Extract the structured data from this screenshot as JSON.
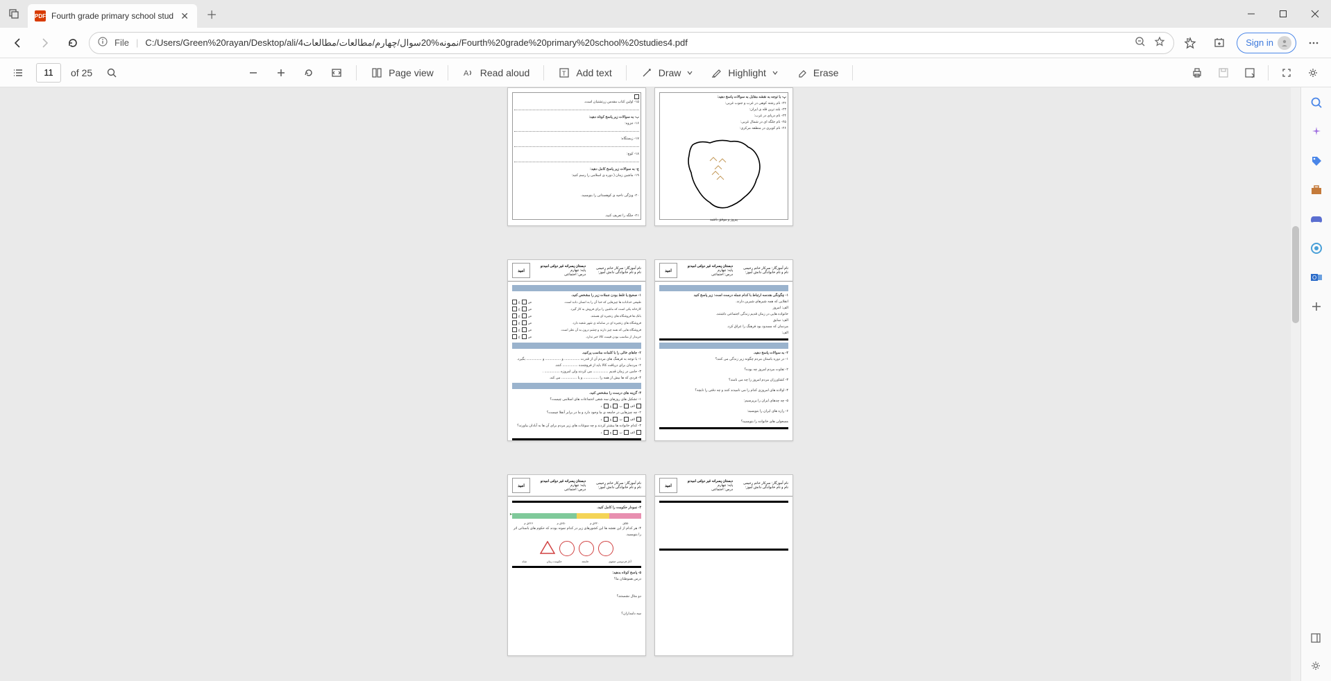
{
  "tab": {
    "title": "Fourth grade primary school stud"
  },
  "address": {
    "file_label": "File",
    "url": "C:/Users/Green%20rayan/Desktop/ali/نمونه%20سوال/چهارم/مطالعات/مطالعات4/Fourth%20grade%20primary%20school%20studies4.pdf"
  },
  "signin": "Sign in",
  "pdf_toolbar": {
    "page_current": "11",
    "page_total_label": "of 25",
    "page_view": "Page view",
    "read_aloud": "Read aloud",
    "add_text": "Add text",
    "draw": "Draw",
    "highlight": "Highlight",
    "erase": "Erase"
  },
  "doc": {
    "school_name": "دبستان پسرانه غیر دولتی امیدنو",
    "teacher": "نام آموزگار: سرکار خانم رحیمی",
    "grade": "پایه: چهارم",
    "subject": "درس: اجتماعی",
    "student": "نام و نام خانوادگی دانش آموز:",
    "logo_text": "امید",
    "page10": {
      "line1": "۱۵- اولین کتاب مقدس زرتشتیان است.",
      "section_title": "ب- به سوالات زیر پاسخ کوتاه دهید:",
      "item16": "۱۶- جزوه:",
      "item17": "۱۷- زیستگاه:",
      "item18": "۱۸- کوچ:",
      "section2": "ج- به سوالات زیر پاسخ کامل دهید:",
      "q19": "۱۹- ماشین زمان ( دوره ی اسلامی را رسم کنید:",
      "q20": "۲۰- ویژگی ناحیه ی کوهستانی را بنویسید.",
      "q21": "۲۱- جلگه را تعریف کنید."
    },
    "page11": {
      "title": "پ- با توجه به نقشه مقابل به سوالات پاسخ دهید:",
      "q22": "۲۲- نام رشته کوهی در غرب و جنوب غربی:",
      "q23": "۲۳- بلند ترین قله ی ایران:",
      "q24": "۲۴- نام دریای در غرب:",
      "q25": "۲۵- نام جلگه ای در شمال غربی:",
      "q26": "۲۶- نام کویری در منطقه مرکزی:",
      "footer": "پیروز و موفق باشید"
    },
    "page12": {
      "sec1": "۱- صحیح یا غلط بودن جملات زیر را مشخص کنید.",
      "r1": "طبیعی خداداده ها چیزهایی که خدا آن را به انسان داده است.",
      "r2": "کارخانه یکی است که ماشین را برای فروش به کار گیرد.",
      "r3": "بانک ها فروشگاه های زنجیره ای هستند.",
      "r4": "فروشگاه های زنجیره ای در سامانه ی شهر شعبه دارد.",
      "r5": "فروشگاه هایی که همه چیز دارند و چشم درون به آن نظر است.",
      "r6": "خریدار از مناسب بودن قیمت کالا خبر ندارد.",
      "l_correct": "ص",
      "l_wrong": "غ",
      "sec2": "۲- جاهای خالی را با کلمات مناسب پرکنید.",
      "f1": "۱- با توجه به فرهنگ های مردم آن از قدرت ................ و ................ و ................ بگیرد.",
      "f2": "۲- مردمان برای دریافت کالا باید از فروشنده ................ کنند.",
      "f3": "۳- حامی در زمان قدیم ................ می کردند ولی امروزه ................ .",
      "f4": "۴- فردی که ها بیش از همه را ................ و یا ................ می کند.",
      "sec3": "۳- گزینه های درست را مشخص کنید.",
      "mc1": "۱- تشکیل های روزهای سه شقی اجتماعات های اسلامی چیست؟",
      "mc2": "۲- چه چیزهایی در جامعه ی ما وجود دارد و ما در برابر آنفلا چیست؟",
      "mc3": "۳- کدام خانواده ها بیشتر کردند و چه سوغات های زیر مردم برای آن ها به آبادان بیاورند؟"
    },
    "page13": {
      "sec1": "۱- چگونگی هندسه ارتباط با کدام جمله درست است: زیر پاسخ کنید",
      "r1": "انقلایی که همه شیرهای شیرین دارند.",
      "r2": "الف: امروز",
      "r3": "خانواده هایی در زمان قدیم زندگی اجتماعی داشتند.",
      "r4": "الف: سابق",
      "r5": "مردمان که مسدود بود فرهنگ را عراق کرد.",
      "r6": "الف:",
      "sec2": "۲- به سوالات پاسخ دهید.",
      "q1": "۱- در دوره باستان مردم چگونه زیر زندگی می کنند؟",
      "q2": "۲- تفاوت مردم امروز چه بوده؟",
      "q3": "۳- کشاورزان مردم امروز را چه می نامند؟",
      "q4": "۴- اولاده های امروزی کدام را می نامیدند کنند و چه دقتی را نابچه؟",
      "q5": "۵- چه چدهای ایران را برپرسیم:",
      "q6": "۶- رازه های ایران را بنویسید:",
      "q7": "مسعولی های خانواده را بنویسید؟"
    },
    "page14": {
      "sec": "۳- نمودار حکومت را کامل کنید.",
      "timeline_labels": [
        "۵۵۰ق",
        "۳۳۰ق م",
        "۲۵۰ق م",
        "۲۲۶ق م"
      ],
      "shape_labels": [
        "آثار فردوسی صفوی",
        "جامعه",
        "حکومت زمان",
        "شاه"
      ],
      "sec2": "۴- هر کدام از این نقشه ها این کشورهای زیر در کدام نمونه بودند که حکوم های باستانی اثر را بنویسید.",
      "sec3": "۵- پاسخ کوتاه بدهید:",
      "q1": "درس هموطنان ما؟",
      "q2": "دو مثال نشستند؟",
      "q3": "سه دامداران؟"
    }
  }
}
